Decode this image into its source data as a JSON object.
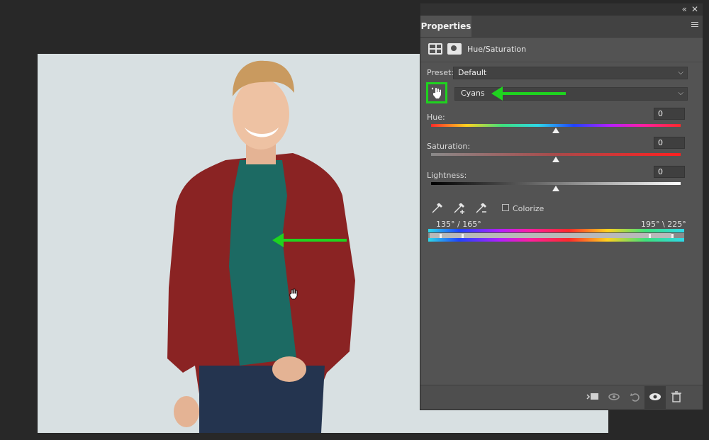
{
  "panel": {
    "topbar": {
      "collapse_icon": "double-chevron-icon",
      "close_label": "✕"
    },
    "tab_label": "Properties",
    "adjustment_title": "Hue/Saturation",
    "preset": {
      "label": "Preset:",
      "value": "Default"
    },
    "channel": {
      "value": "Cyans"
    },
    "hue": {
      "label": "Hue:",
      "value": "0"
    },
    "saturation": {
      "label": "Saturation:",
      "value": "0"
    },
    "lightness": {
      "label": "Lightness:",
      "value": "0"
    },
    "colorize": {
      "label": "Colorize",
      "checked": false
    },
    "range": {
      "left_label": "135° / 165°",
      "right_label": "195° \\ 225°"
    },
    "bottom_icons": [
      "clip-to-layer-icon",
      "view-previous-state-icon",
      "reset-icon",
      "visibility-eye-icon",
      "trash-icon"
    ]
  },
  "annotations": {
    "highlight_color": "#1fd31f"
  }
}
